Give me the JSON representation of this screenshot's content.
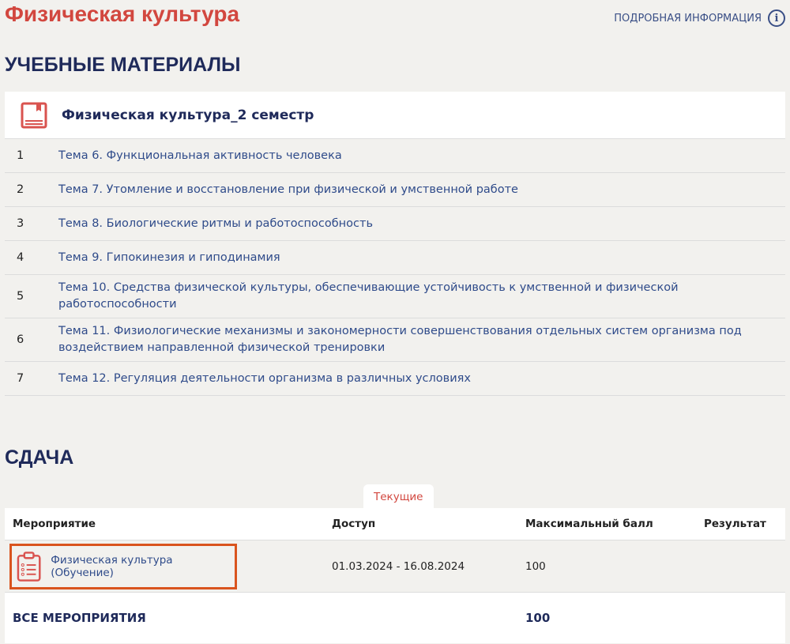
{
  "title": "Физическая культура",
  "more_info": "ПОДРОБНАЯ ИНФОРМАЦИЯ",
  "materials": {
    "heading": "УЧЕБНЫЕ МАТЕРИАЛЫ",
    "block_title": "Физическая культура_2 семестр",
    "items": [
      {
        "n": "1",
        "label": "Тема 6. Функциональная активность человека"
      },
      {
        "n": "2",
        "label": "Тема 7. Утомление и восстановление при физической и умственной работе"
      },
      {
        "n": "3",
        "label": "Тема 8. Биологические ритмы и работоспособность"
      },
      {
        "n": "4",
        "label": "Тема 9. Гипокинезия и гиподинамия"
      },
      {
        "n": "5",
        "label": "Тема 10. Средства физической культуры, обеспечивающие устойчивость к умственной и физической работоспособности"
      },
      {
        "n": "6",
        "label": "Тема 11. Физиологические механизмы и закономерности совершенствования отдельных систем организма под воздействием направленной физической тренировки"
      },
      {
        "n": "7",
        "label": "Тема 12. Регуляция деятельности организма в различных условиях"
      }
    ]
  },
  "submission": {
    "heading": "СДАЧА",
    "tab": "Текущие",
    "columns": [
      "Мероприятие",
      "Доступ",
      "Максимальный балл",
      "Результат"
    ],
    "row": {
      "event": "Физическая культура (Обучение)",
      "access": "01.03.2024 - 16.08.2024",
      "max": "100",
      "result": ""
    },
    "total": {
      "label": "ВСЕ МЕРОПРИЯТИЯ",
      "max": "100"
    }
  }
}
